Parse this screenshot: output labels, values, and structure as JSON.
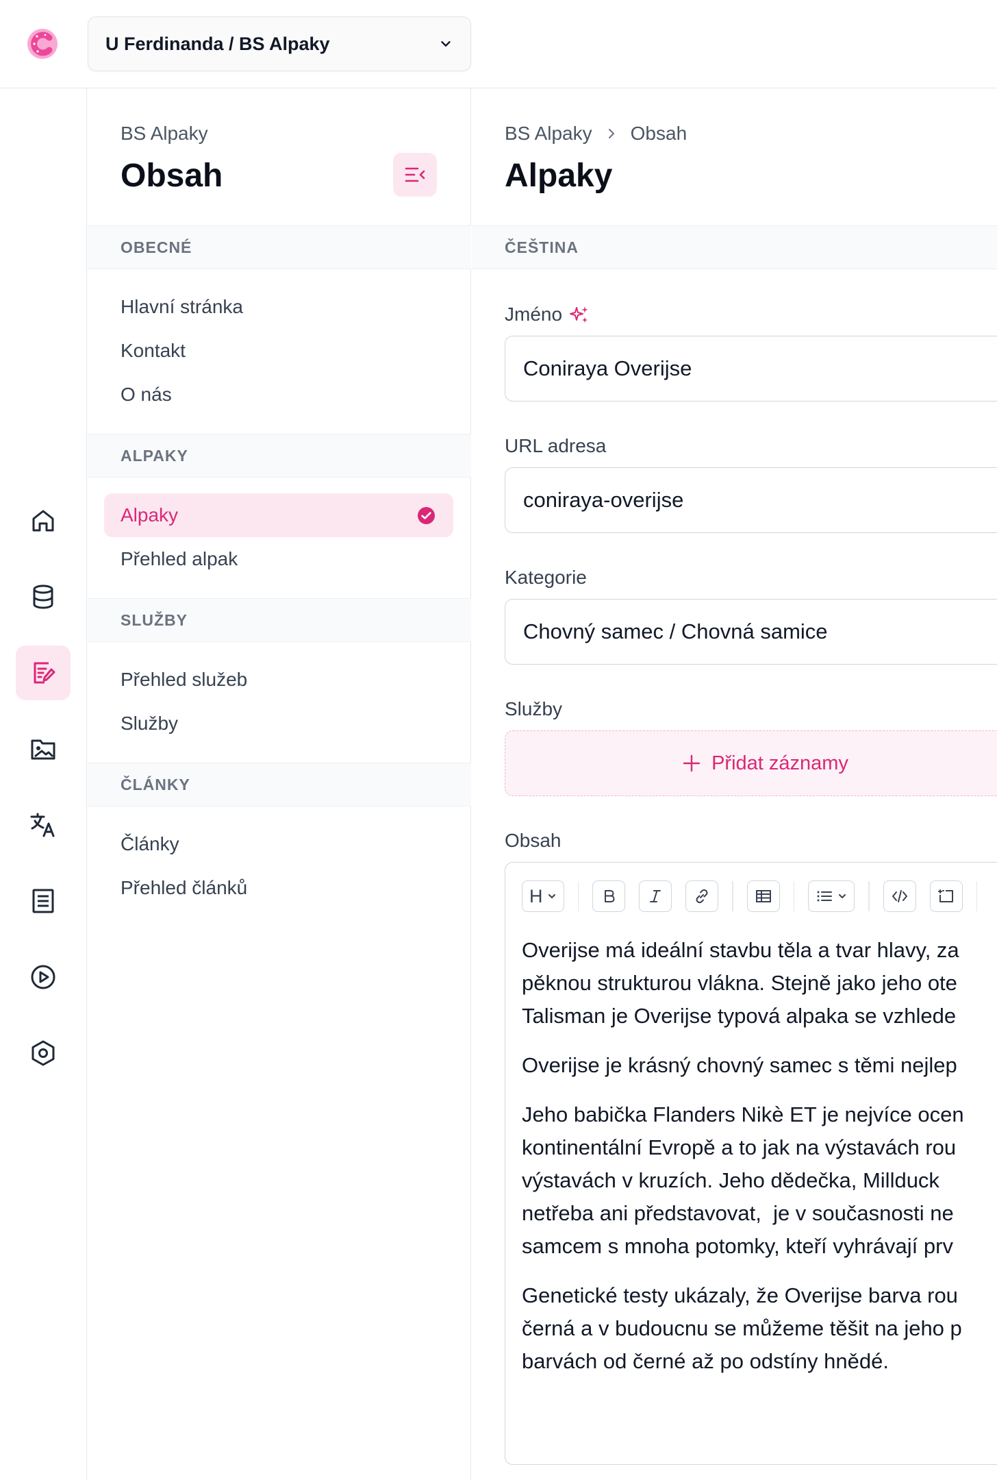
{
  "topbar": {
    "project_label": "U Ferdinanda / BS Alpaky"
  },
  "rail": {
    "items": [
      {
        "icon": "home-icon",
        "active": false
      },
      {
        "icon": "database-icon",
        "active": false
      },
      {
        "icon": "edit-document-icon",
        "active": true
      },
      {
        "icon": "media-folder-icon",
        "active": false
      },
      {
        "icon": "translate-icon",
        "active": false
      },
      {
        "icon": "form-icon",
        "active": false
      },
      {
        "icon": "play-icon",
        "active": false
      },
      {
        "icon": "settings-hexagon-icon",
        "active": false
      }
    ]
  },
  "nav": {
    "subtitle": "BS Alpaky",
    "title": "Obsah",
    "sections": [
      {
        "heading": "OBECNÉ",
        "items": [
          "Hlavní stránka",
          "Kontakt",
          "O nás"
        ]
      },
      {
        "heading": "ALPAKY",
        "items": [
          "Alpaky",
          "Přehled alpak"
        ]
      },
      {
        "heading": "SLUŽBY",
        "items": [
          "Přehled služeb",
          "Služby"
        ]
      },
      {
        "heading": "ČLÁNKY",
        "items": [
          "Články",
          "Přehled článků"
        ]
      }
    ],
    "active_item": "Alpaky"
  },
  "main": {
    "breadcrumb": [
      "BS Alpaky",
      "Obsah"
    ],
    "title": "Alpaky",
    "language": "ČEŠTINA",
    "fields": {
      "name_label": "Jméno",
      "name_value": "Coniraya Overijse",
      "url_label": "URL adresa",
      "url_value": "coniraya-overijse",
      "category_label": "Kategorie",
      "category_value": "Chovný samec / Chovná samice",
      "services_label": "Služby",
      "add_records_label": "Přidat záznamy",
      "content_label": "Obsah"
    },
    "editor": {
      "heading_button": "H",
      "toolbar_icons": [
        "bold-icon",
        "italic-icon",
        "link-icon",
        "table-icon",
        "list-icon",
        "code-icon",
        "embed-icon"
      ],
      "paragraphs": [
        "Overijse má ideální stavbu těla a tvar hlavy, za\npěknou strukturou vlákna. Stejně jako jeho ote\nTalisman je Overijse typová alpaka se vzhlede",
        "Overijse je krásný chovný samec s těmi nejlep",
        "Jeho babička Flanders Nikè ET je nejvíce ocen\nkontinentální Evropě a to jak na výstavách rou\nvýstavách v kruzích. Jeho dědečka, Millduck\nnetřeba ani představovat,  je v současnosti ne\nsamcem s mnoha potomky, kteří vyhrávají prv",
        "Genetické testy ukázaly, že Overijse barva rou\nčerná a v budoucnu se můžeme těšit na jeho p\nbarvách od černé až po odstíny hnědé."
      ]
    }
  },
  "colors": {
    "accent": "#db2777",
    "accent_bg": "#fce7f1",
    "border": "#d1d5db",
    "muted_text": "#6b7280"
  }
}
